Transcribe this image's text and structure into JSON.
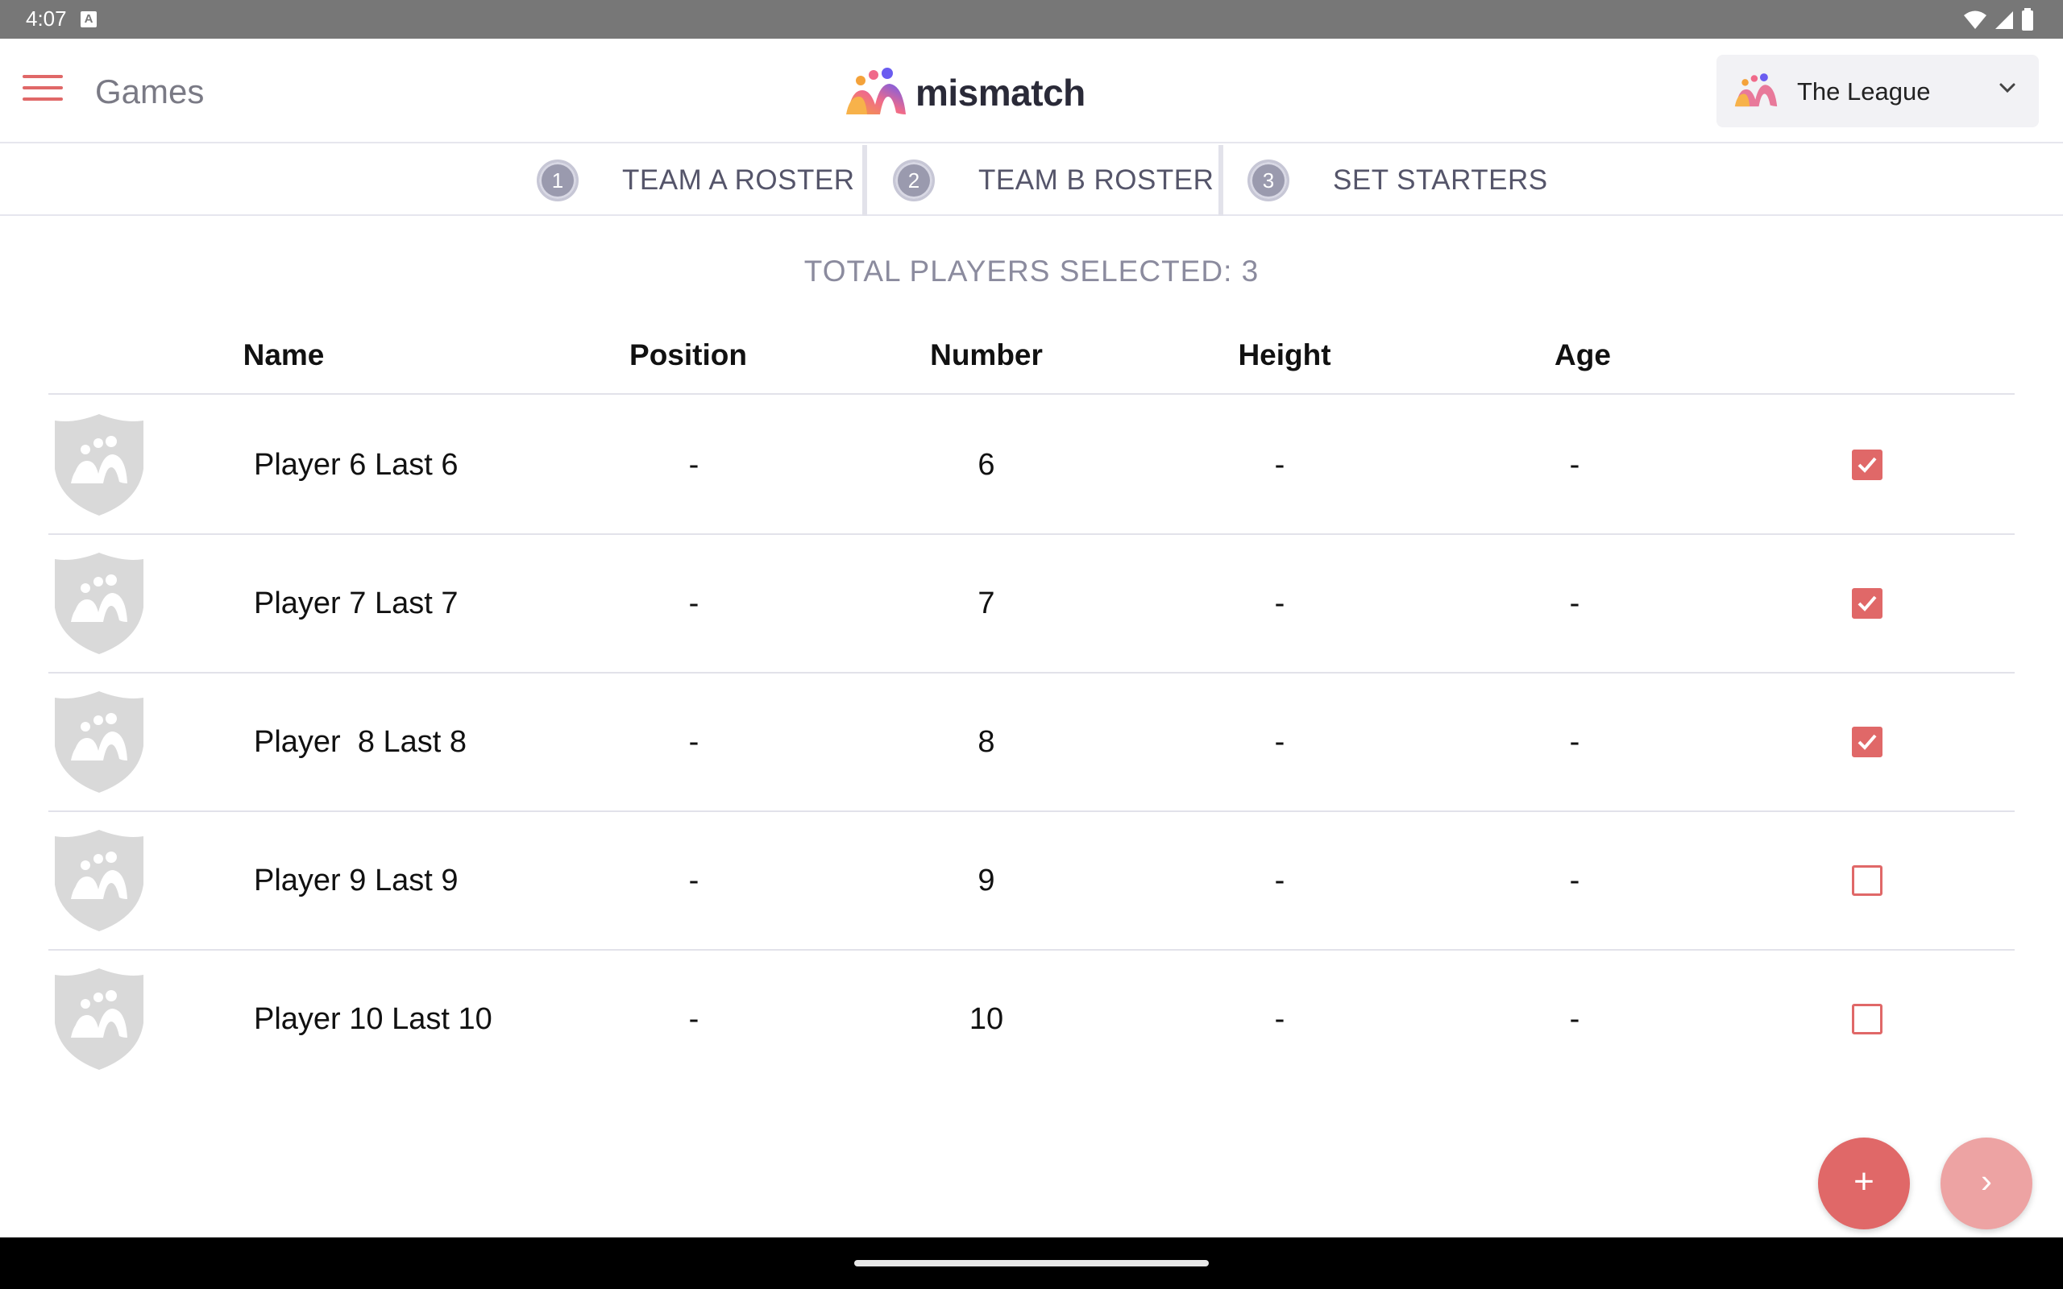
{
  "status_bar": {
    "time": "4:07",
    "indicator": "A"
  },
  "app_bar": {
    "title": "Games",
    "brand_name": "mismatch",
    "league_selector": {
      "selected": "The League"
    }
  },
  "stepper": {
    "steps": [
      {
        "number": "1",
        "label": "TEAM A ROSTER"
      },
      {
        "number": "2",
        "label": "TEAM B ROSTER"
      },
      {
        "number": "3",
        "label": "SET STARTERS"
      }
    ]
  },
  "summary": {
    "total_label": "TOTAL PLAYERS SELECTED: 3"
  },
  "table": {
    "headers": [
      "Name",
      "Position",
      "Number",
      "Height",
      "Age"
    ],
    "rows": [
      {
        "name": "Player 6 Last 6",
        "position": "-",
        "number": "6",
        "height": "-",
        "age": "-",
        "selected": true
      },
      {
        "name": "Player 7 Last 7",
        "position": "-",
        "number": "7",
        "height": "-",
        "age": "-",
        "selected": true
      },
      {
        "name": "Player  8 Last 8",
        "position": "-",
        "number": "8",
        "height": "-",
        "age": "-",
        "selected": true
      },
      {
        "name": "Player 9 Last 9",
        "position": "-",
        "number": "9",
        "height": "-",
        "age": "-",
        "selected": false
      },
      {
        "name": "Player 10 Last 10",
        "position": "-",
        "number": "10",
        "height": "-",
        "age": "-",
        "selected": false
      }
    ]
  },
  "fabs": {
    "add_symbol": "+",
    "next_symbol": "›"
  },
  "icons": {
    "menu": "hamburger-icon",
    "brand": "mismatch-logo-icon",
    "dropdown": "chevron-down-icon",
    "avatar": "player-shield-icon",
    "check": "check-icon"
  },
  "colors": {
    "accent": "#e06868",
    "accent_light": "#eda3a3",
    "step_circle": "#9a9aae",
    "muted_text": "#8b8b9e"
  }
}
